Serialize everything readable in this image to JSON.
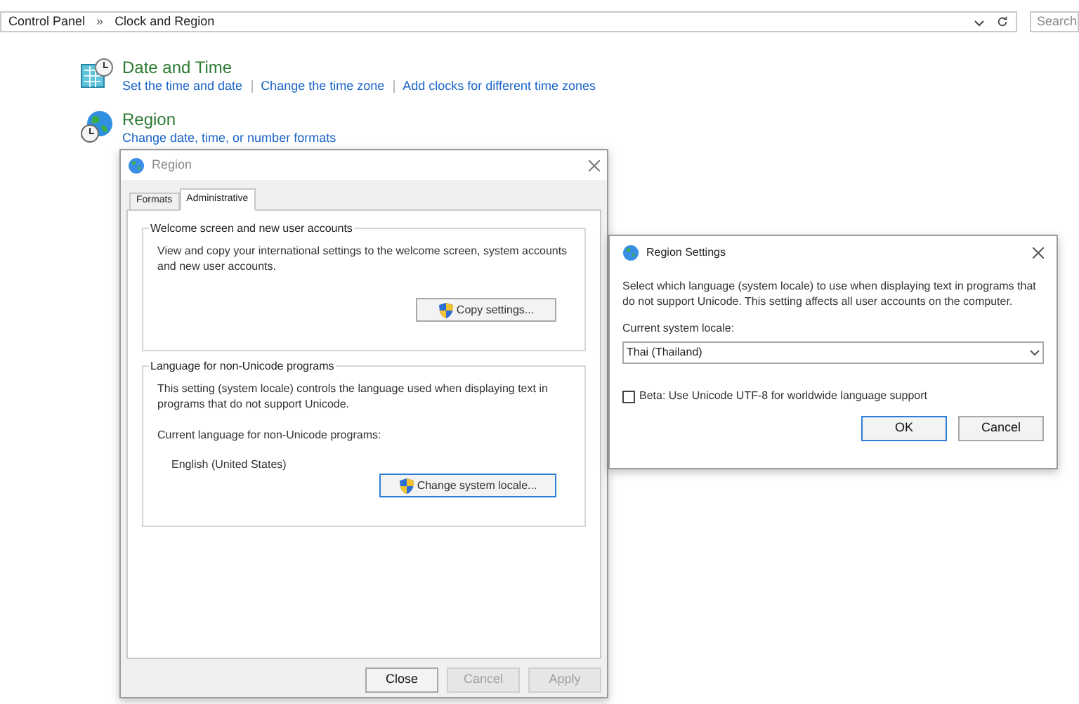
{
  "address_bar": {
    "breadcrumbs": [
      "Control Panel",
      "Clock and Region"
    ],
    "separator": "»"
  },
  "search": {
    "placeholder": "Search"
  },
  "categories": [
    {
      "kind": "clock",
      "title": "Date and Time",
      "links": [
        "Set the time and date",
        "Change the time zone",
        "Add clocks for different time zones"
      ]
    },
    {
      "kind": "globe",
      "title": "Region",
      "links": [
        "Change date, time, or number formats"
      ]
    }
  ],
  "region_dialog": {
    "title": "Region",
    "tabs": [
      {
        "label": "Formats",
        "selected": false
      },
      {
        "label": "Administrative",
        "selected": true
      }
    ],
    "groups": [
      {
        "title": "Welcome screen and new user accounts",
        "text": "View and copy your international settings to the welcome screen, system accounts and new user accounts.",
        "button": {
          "label": "Copy settings...",
          "focused": false
        }
      },
      {
        "title": "Language for non-Unicode programs",
        "text": "This setting (system locale) controls the language used when displaying text in programs that do not support Unicode.",
        "label": "Current language for non-Unicode programs:",
        "value": "English (United States)",
        "button": {
          "label": "Change system locale...",
          "focused": true
        }
      }
    ],
    "buttons": [
      {
        "label": "Close",
        "disabled": false
      },
      {
        "label": "Cancel",
        "disabled": true
      },
      {
        "label": "Apply",
        "disabled": true
      }
    ]
  },
  "settings_dialog": {
    "title": "Region Settings",
    "text": "Select which language (system locale) to use when displaying text in programs that do not support Unicode. This setting affects all user accounts on the computer.",
    "locale_label": "Current system locale:",
    "locale": "Thai (Thailand)",
    "beta": {
      "label": "Beta: Use Unicode UTF-8 for worldwide language support",
      "checked": false
    },
    "buttons": [
      {
        "label": "OK",
        "focused": true
      },
      {
        "label": "Cancel",
        "focused": false
      }
    ]
  }
}
